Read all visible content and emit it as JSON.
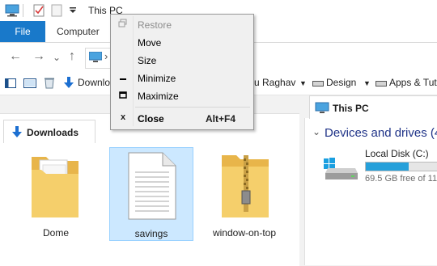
{
  "window": {
    "title": "This PC"
  },
  "ribbon": {
    "file_tab": "File",
    "computer_tab": "Computer"
  },
  "nav": {
    "separator": "›"
  },
  "quick_access": {
    "downloads_label": "Downlo",
    "user_label": "u Raghav",
    "design_label": "Design",
    "apps_label": "Apps & Tut"
  },
  "left_pane": {
    "tab_label": "Downloads",
    "files": [
      {
        "name": "Dome",
        "icon": "folder-icon",
        "selected": false
      },
      {
        "name": "savings",
        "icon": "text-document-icon",
        "selected": true
      },
      {
        "name": "window-on-top",
        "icon": "zip-folder-icon",
        "selected": false
      }
    ]
  },
  "right_pane": {
    "tab_label": "This PC",
    "section_header": "Devices and drives (4",
    "drive": {
      "name": "Local Disk (C:)",
      "free_text": "69.5 GB free of 11",
      "used_fraction": 0.6
    }
  },
  "system_menu": {
    "items": [
      {
        "label": "Restore",
        "glyph": "restore-icon",
        "enabled": false
      },
      {
        "label": "Move",
        "glyph": "",
        "enabled": true
      },
      {
        "label": "Size",
        "glyph": "",
        "enabled": true
      },
      {
        "label": "Minimize",
        "glyph": "minimize-icon",
        "enabled": true
      },
      {
        "label": "Maximize",
        "glyph": "maximize-icon",
        "enabled": true
      },
      {
        "label": "Close",
        "glyph": "close-icon",
        "enabled": true,
        "shortcut": "Alt+F4",
        "bold": true
      }
    ]
  },
  "colors": {
    "accent": "#1979ca",
    "selection": "#cce8ff",
    "drive_bar": "#26a0da",
    "header_blue": "#1e3287"
  }
}
